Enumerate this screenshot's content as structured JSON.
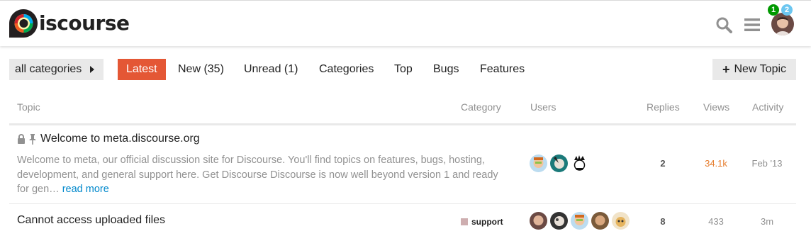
{
  "header": {
    "logo_text": "iscourse",
    "logo_alt": "Discourse",
    "badges": {
      "notifications": "1",
      "messages": "2"
    }
  },
  "nav": {
    "category_dropdown": "all categories",
    "items": [
      {
        "label": "Latest",
        "active": true
      },
      {
        "label": "New (35)"
      },
      {
        "label": "Unread (1)"
      },
      {
        "label": "Categories"
      },
      {
        "label": "Top"
      },
      {
        "label": "Bugs"
      },
      {
        "label": "Features"
      }
    ],
    "new_topic": "New Topic"
  },
  "table": {
    "headers": {
      "topic": "Topic",
      "category": "Category",
      "users": "Users",
      "replies": "Replies",
      "views": "Views",
      "activity": "Activity"
    },
    "rows": [
      {
        "title": "Welcome to meta.discourse.org",
        "excerpt": "Welcome to meta, our official discussion site for Discourse. You'll find topics on features, bugs, hosting, development, and general support here. Get Discourse Discourse is now well beyond version 1 and ready for gen…",
        "read_more": "read more",
        "category": "",
        "replies": "2",
        "views": "34.1k",
        "activity": "Feb '13",
        "pinned": true,
        "locked": true
      },
      {
        "title": "Cannot access uploaded files",
        "category": "support",
        "category_color": "#ceaeb0",
        "replies": "8",
        "views": "433",
        "activity": "3m"
      }
    ]
  },
  "colors": {
    "accent": "#e45735",
    "views_hot": "#e67c2d",
    "muted": "#919191",
    "link": "#0088cc"
  }
}
